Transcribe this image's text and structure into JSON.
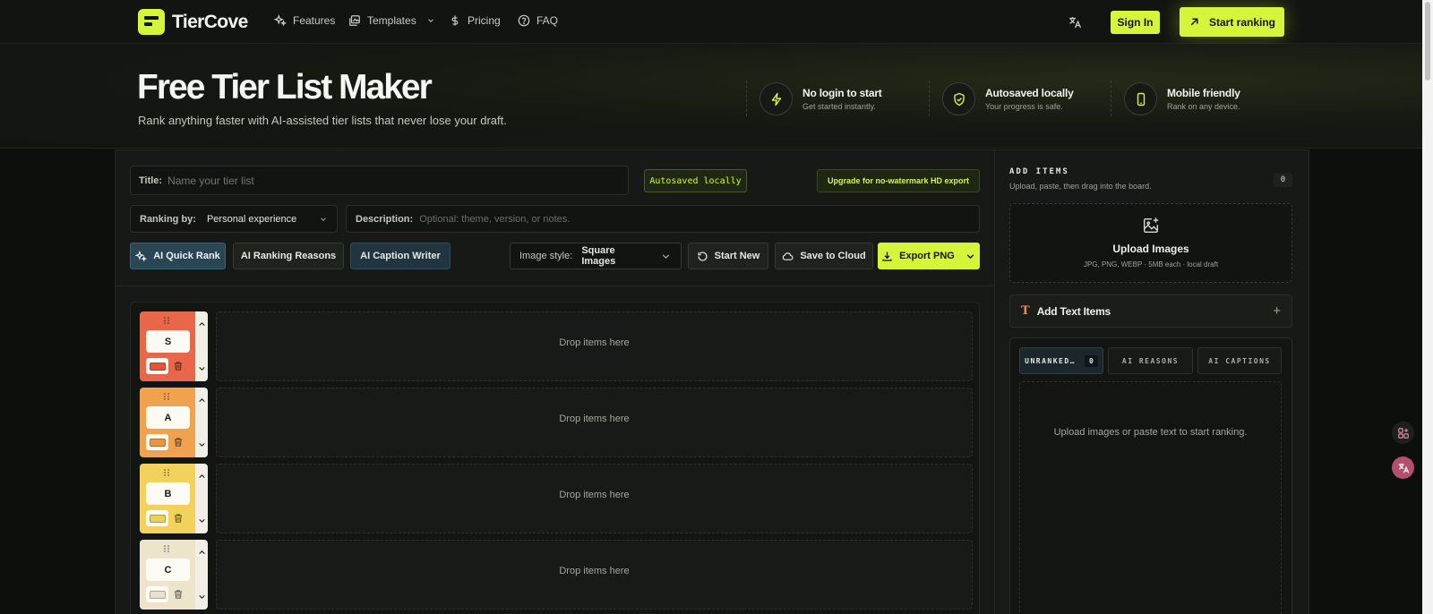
{
  "nav": {
    "brand": "TierCove",
    "links": [
      {
        "label": "Features",
        "icon": "sparkles-icon"
      },
      {
        "label": "Templates",
        "icon": "gallery-icon"
      },
      {
        "label": "Pricing",
        "icon": "dollar-icon"
      },
      {
        "label": "FAQ",
        "icon": "help-icon"
      }
    ],
    "sign_in": "Sign In",
    "start": "Start ranking"
  },
  "hero": {
    "title": "Free Tier List Maker",
    "subtitle": "Rank anything faster with AI-assisted tier lists that never lose your draft.",
    "features": [
      {
        "title": "No login to start",
        "sub": "Get started instantly.",
        "icon": "bolt-icon"
      },
      {
        "title": "Autosaved locally",
        "sub": "Your progress is safe.",
        "icon": "shield-check-icon"
      },
      {
        "title": "Mobile friendly",
        "sub": "Rank on any device.",
        "icon": "phone-icon"
      }
    ]
  },
  "editor": {
    "title_label": "Title:",
    "title_placeholder": "Name your tier list",
    "autosave_tag": "Autosaved locally",
    "upgrade": "Upgrade for no-watermark HD export",
    "ranking_label": "Ranking by:",
    "ranking_value": "Personal experience",
    "desc_label": "Description:",
    "desc_placeholder": "Optional: theme, version, or notes.",
    "ai_quick": "AI Quick Rank",
    "ai_reasons": "AI Ranking Reasons",
    "ai_caption": "AI Caption Writer",
    "image_style_label": "Image style:",
    "image_style_value": "Square Images",
    "start_new": "Start New",
    "save_cloud": "Save to Cloud",
    "export": "Export PNG"
  },
  "tiers": [
    {
      "name": "S",
      "color": "#e8664a",
      "swatch": "#e0573e",
      "drop": "Drop items here"
    },
    {
      "name": "A",
      "color": "#f0a24f",
      "swatch": "#e9953f",
      "drop": "Drop items here"
    },
    {
      "name": "B",
      "color": "#f2d25d",
      "swatch": "#eed058",
      "drop": "Drop items here"
    },
    {
      "name": "C",
      "color": "#ede4cc",
      "swatch": "#e6e0cf",
      "drop": "Drop items here"
    }
  ],
  "side": {
    "title": "ADD ITEMS",
    "sub": "Upload, paste, then drag into the board.",
    "count": "0",
    "upload_title": "Upload Images",
    "upload_sub": "JPG, PNG, WEBP · 5MB each · local draft",
    "text_items": "Add Text Items",
    "tab_unranked": "UNRANKED…",
    "tab_unranked_count": "0",
    "tab_reasons": "AI REASONS",
    "tab_captions": "AI CAPTIONS",
    "empty": "Upload images or paste text to start ranking."
  },
  "colors": {
    "accent": "#d4f53a",
    "background": "#0d0f0c"
  }
}
